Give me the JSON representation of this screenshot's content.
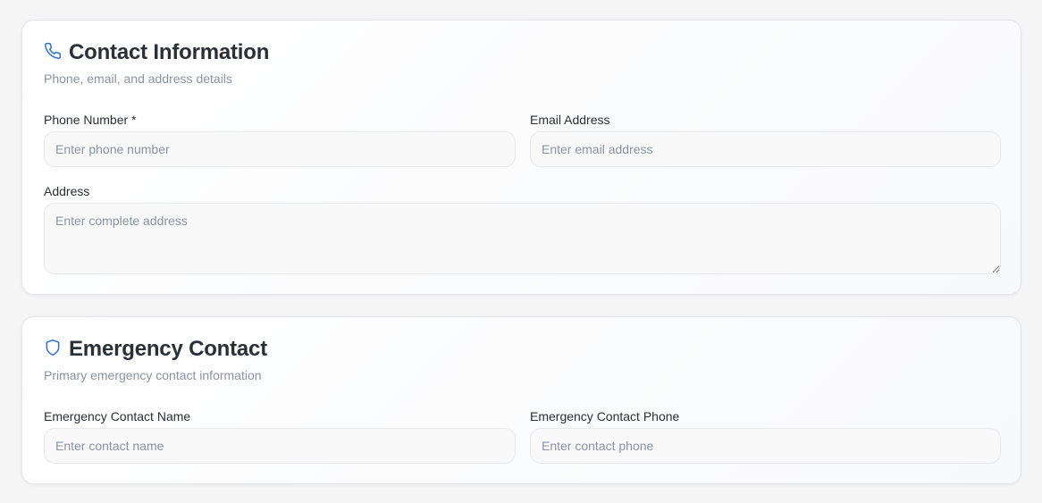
{
  "contact": {
    "icon": "phone-icon",
    "title": "Contact Information",
    "subtitle": "Phone, email, and address details",
    "phone": {
      "label": "Phone Number *",
      "placeholder": "Enter phone number",
      "value": ""
    },
    "email": {
      "label": "Email Address",
      "placeholder": "Enter email address",
      "value": ""
    },
    "address": {
      "label": "Address",
      "placeholder": "Enter complete address",
      "value": ""
    }
  },
  "emergency": {
    "icon": "shield-icon",
    "title": "Emergency Contact",
    "subtitle": "Primary emergency contact information",
    "name": {
      "label": "Emergency Contact Name",
      "placeholder": "Enter contact name",
      "value": ""
    },
    "phone": {
      "label": "Emergency Contact Phone",
      "placeholder": "Enter contact phone",
      "value": ""
    }
  },
  "colors": {
    "accent": "#2f6fd6",
    "text": "#2b2f36",
    "muted": "#8a93a3"
  }
}
